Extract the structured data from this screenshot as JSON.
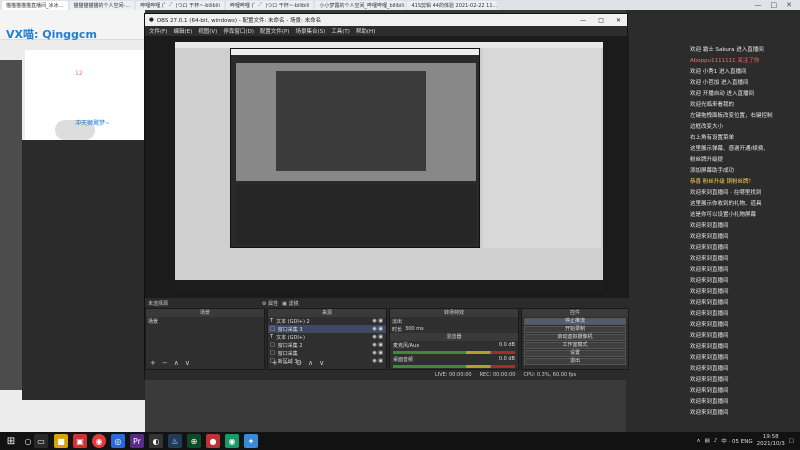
{
  "browser": {
    "tabs": [
      {
        "label": "猫猫猫猫猫直播间_冰冰…",
        "active": true
      },
      {
        "label": "猫猫猫猫猫的个人空间-…",
        "active": false
      },
      {
        "label": "哔哩哔哩 (゜-゜)つロ 干杯~-bilibili",
        "active": false
      },
      {
        "label": "哔哩哔哩 (゜-゜)つロ 干杯~-bilibili",
        "active": false
      },
      {
        "label": "小小梦露的个人空间_哔哩哔哩_bilibili",
        "active": false
      },
      {
        "label": "41S剪辑 44的体验 2021-02-22 11...",
        "active": false
      }
    ]
  },
  "left_page": {
    "watermark": "VX喵: Qinggcm",
    "streamer": "冲天狮鹫梦~",
    "stat": "12"
  },
  "obs": {
    "title": "OBS 27.0.1 (64-bit, windows) - 配置文件: 未命名 - 场景: 未命名",
    "menu": [
      "文件(F)",
      "编辑(E)",
      "视图(V)",
      "停靠窗口(D)",
      "配置文件(P)",
      "场景集合(S)",
      "工具(T)",
      "帮助(H)"
    ],
    "source_bar": {
      "label": "未选择源",
      "props": "属性",
      "filters": "滤镜"
    },
    "docks": {
      "scenes": {
        "title": "场景",
        "items": [
          "场景"
        ]
      },
      "sources": {
        "title": "来源",
        "items": [
          {
            "type": "T",
            "label": "文本 (GDI+) 2"
          },
          {
            "type": "□",
            "label": "窗口采集 3"
          },
          {
            "type": "T",
            "label": "文本 (GDI+)"
          },
          {
            "type": "□",
            "label": "窗口采集 2"
          },
          {
            "type": "□",
            "label": "窗口采集"
          },
          {
            "type": "□",
            "label": "新区域 3"
          }
        ]
      },
      "transitions": {
        "title": "转场特效",
        "mode": "淡出",
        "duration_label": "时长",
        "duration": "300 ms"
      },
      "mixer": {
        "title": "混音器",
        "channels": [
          {
            "name": "麦克风/Aux",
            "value": "0.0 dB"
          },
          {
            "name": "桌面音频",
            "value": "0.0 dB"
          }
        ]
      },
      "controls": {
        "title": "控件",
        "buttons": [
          "停止推流",
          "开始录制",
          "启动虚拟摄像机",
          "工作室模式",
          "设置",
          "退出"
        ]
      }
    },
    "status": {
      "live": "LIVE: 00:00:00",
      "rec": "REC: 00:00:00",
      "cpu": "CPU: 0.3%, 60.00 fps"
    }
  },
  "chat": {
    "messages": [
      {
        "text": "欢迎 霜士 Sakura 进入直播间",
        "style": "normal"
      },
      {
        "text": "Aboppu1111111 关注了你",
        "style": "hl"
      },
      {
        "text": "欢迎 小秀1 进入直播间",
        "style": "normal"
      },
      {
        "text": "欢迎 小芭加 进入直播间",
        "style": "normal"
      },
      {
        "text": "欢迎 开播自动 进入直播间",
        "style": "normal"
      },
      {
        "text": "欢迎光临来看我的",
        "style": "normal"
      },
      {
        "text": "左键拖拽面板改变位置，右键控制",
        "style": "normal"
      },
      {
        "text": "边框改变大小",
        "style": "normal"
      },
      {
        "text": "右上角有设置菜单",
        "style": "normal"
      },
      {
        "text": "这里展示弹幕、感谢开通/续费、",
        "style": "normal"
      },
      {
        "text": "粉丝牌升级提",
        "style": "normal"
      },
      {
        "text": "添加屏幕助手成功",
        "style": "normal"
      },
      {
        "text": "恭喜 粉丝升级 铜粉丝牌！",
        "style": "yl"
      },
      {
        "text": "欢迎来到直播间 · 在哪里找到",
        "style": "normal"
      },
      {
        "text": "这里展示你收到的礼物、道具",
        "style": "normal"
      },
      {
        "text": "这是你可以设置小礼物屏幕",
        "style": "normal"
      },
      {
        "text": "欢迎来到直播间",
        "style": "normal"
      },
      {
        "text": "欢迎来到直播间",
        "style": "normal"
      },
      {
        "text": "欢迎来到直播间",
        "style": "normal"
      },
      {
        "text": "欢迎来到直播间",
        "style": "normal"
      },
      {
        "text": "欢迎来到直播间",
        "style": "normal"
      },
      {
        "text": "欢迎来到直播间",
        "style": "normal"
      },
      {
        "text": "欢迎来到直播间",
        "style": "normal"
      },
      {
        "text": "欢迎来到直播间",
        "style": "normal"
      },
      {
        "text": "欢迎来到直播间",
        "style": "normal"
      },
      {
        "text": "欢迎来到直播间",
        "style": "normal"
      },
      {
        "text": "欢迎来到直播间",
        "style": "normal"
      },
      {
        "text": "欢迎来到直播间",
        "style": "normal"
      },
      {
        "text": "欢迎来到直播间",
        "style": "normal"
      },
      {
        "text": "欢迎来到直播间",
        "style": "normal"
      },
      {
        "text": "欢迎来到直播间",
        "style": "normal"
      },
      {
        "text": "欢迎来到直播间",
        "style": "normal"
      },
      {
        "text": "欢迎来到直播间",
        "style": "normal"
      },
      {
        "text": "欢迎来到直播间",
        "style": "normal"
      }
    ]
  },
  "taskbar": {
    "lang": "中",
    "lang_code": "中 · 05 ENG",
    "time": "19:58",
    "date": "2021/10/3"
  },
  "colors": {
    "obs_bg": "#272727",
    "accent": "#1f7fd4",
    "highlight": "#ff6a6a",
    "gold": "#ffd250"
  }
}
